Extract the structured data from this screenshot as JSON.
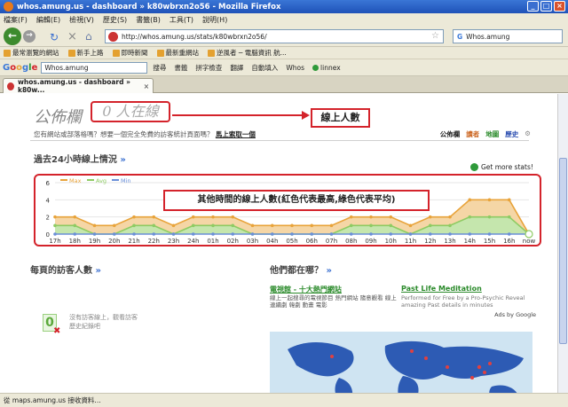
{
  "window": {
    "title": "whos.amung.us - dashboard » k80wbrxn2o56 - Mozilla Firefox",
    "controls": [
      "_",
      "□",
      "×"
    ]
  },
  "menubar": [
    "檔案(F)",
    "編輯(E)",
    "檢視(V)",
    "歷史(S)",
    "書籤(B)",
    "工具(T)",
    "說明(H)"
  ],
  "navbar": {
    "url": "http://whos.amung.us/stats/k80wbrxn2o56/",
    "search_value": "Whos.amung",
    "search_engine_label": "G"
  },
  "bookmarks": [
    "最常瀏覽的網站",
    "新手上路",
    "即時新聞",
    "最新重網站",
    "逆風者 ─ 電腦資訊 航..."
  ],
  "google_toolbar": {
    "logo": "Google",
    "query": "Whos.amung",
    "items": [
      "搜尋",
      "書籤",
      "拼字檢查",
      "翻譯",
      "自動填入",
      "Whos",
      "linnex"
    ]
  },
  "tab": {
    "label": "whos.amung.us - dashboard » k80w...",
    "close": "×"
  },
  "page": {
    "bulletin_title": "公佈欄",
    "online_count": "0 人在線",
    "promo_text": "您有網站或部落格嗎？想要一個完全免費的訪客統計頁面嗎？",
    "promo_link": "馬上索取一個",
    "nav": [
      "公佈欄",
      "讀者",
      "地圖",
      "歷史"
    ],
    "annotation_online": "線上人數",
    "annotation_chart": "其他時間的線上人數(紅色代表最高,綠色代表平均)",
    "past24_title": "過去24小時線上情況",
    "chevron": "»",
    "get_more_stats": "Get more stats!",
    "visitors_title": "每頁的訪客人數",
    "where_title": "他們都在哪？",
    "stat_zero": "0",
    "stat_note": "沒有訪客線上，觀看訪客歷史紀錄吧"
  },
  "ads": {
    "ad1_title": "電視館 - 十大熱門網站",
    "ad1_body": "線上一起搜尋的電視節目 熱門網站 隨意觀看 線上連續劇 韓劇 動畫 電影",
    "ad2_title": "Past Life Meditation",
    "ad2_body": "Performed for Free by a Pro-Psychic Reveal amazing Past details in minutes",
    "ads_by": "Ads by Google"
  },
  "status": "從 maps.amung.us 接收資料...",
  "chart_data": {
    "type": "area",
    "categories": [
      "17h",
      "18h",
      "19h",
      "20h",
      "21h",
      "22h",
      "23h",
      "24h",
      "01h",
      "02h",
      "03h",
      "04h",
      "05h",
      "06h",
      "07h",
      "08h",
      "09h",
      "10h",
      "11h",
      "12h",
      "13h",
      "14h",
      "15h",
      "16h",
      "now"
    ],
    "series": [
      {
        "name": "Max",
        "values": [
          2,
          2,
          1,
          1,
          2,
          2,
          1,
          2,
          2,
          2,
          1,
          1,
          1,
          1,
          1,
          2,
          2,
          2,
          1,
          2,
          2,
          4,
          4,
          4,
          0
        ],
        "color": "#e8a33a"
      },
      {
        "name": "Avg",
        "values": [
          1,
          1,
          0,
          0,
          1,
          1,
          0,
          1,
          1,
          1,
          0,
          0,
          0,
          0,
          0,
          1,
          1,
          1,
          0,
          1,
          1,
          2,
          2,
          2,
          0
        ],
        "color": "#8ecb63"
      },
      {
        "name": "Min",
        "values": [
          0,
          0,
          0,
          0,
          0,
          0,
          0,
          0,
          0,
          0,
          0,
          0,
          0,
          0,
          0,
          0,
          0,
          0,
          0,
          0,
          0,
          0,
          0,
          0,
          0
        ],
        "color": "#6a8fd8"
      }
    ],
    "ylim": [
      0,
      6
    ],
    "yticks": [
      0,
      2,
      4,
      6
    ],
    "legend_position": "top-left",
    "grid": true
  }
}
